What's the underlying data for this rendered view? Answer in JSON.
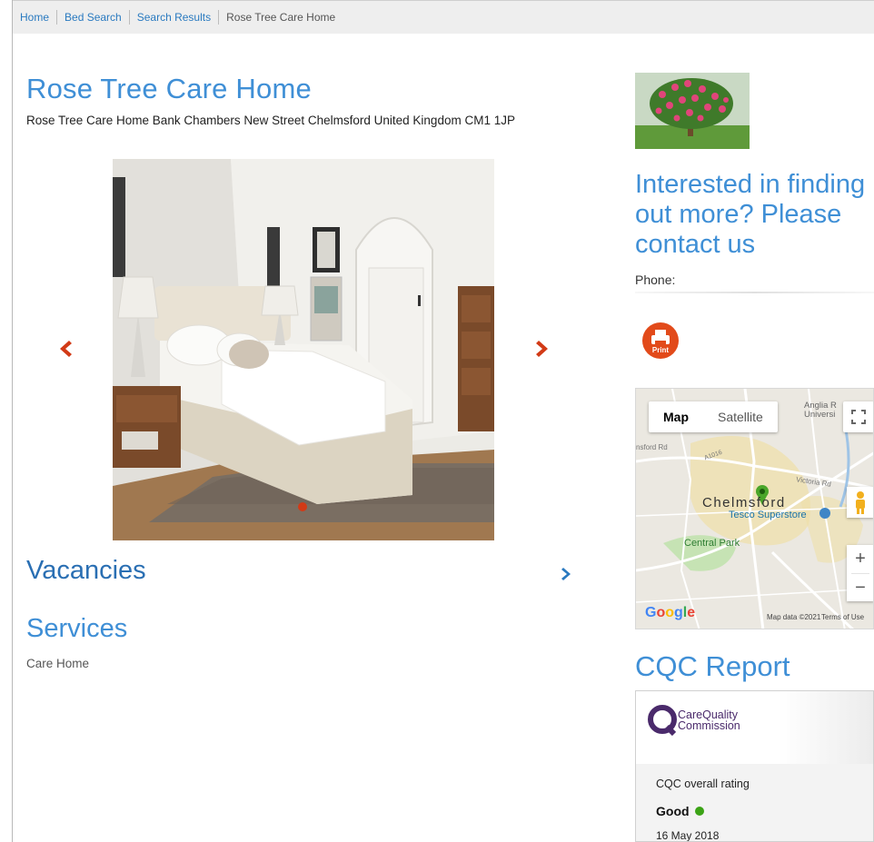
{
  "breadcrumb": {
    "items": [
      {
        "label": "Home"
      },
      {
        "label": "Bed Search"
      },
      {
        "label": "Search Results"
      }
    ],
    "current": "Rose Tree Care Home"
  },
  "home": {
    "title": "Rose Tree Care Home",
    "address": "Rose Tree Care Home Bank Chambers New Street Chelmsford United Kingdom CM1 1JP"
  },
  "carousel": {
    "prev_icon": "chevron-left-icon",
    "next_icon": "chevron-right-icon",
    "accent_color": "#d23a16"
  },
  "sections": {
    "vacancies_title": "Vacancies",
    "services_title": "Services",
    "services": [
      "Care Home"
    ]
  },
  "contact": {
    "heading_lines": [
      "Interested in finding",
      "out more? Please",
      "contact us"
    ],
    "phone_label": "Phone:",
    "print_label": "Print"
  },
  "map": {
    "type_map": "Map",
    "type_satellite": "Satellite",
    "zoom_in": "+",
    "zoom_out": "−",
    "labels": {
      "city": "Chelmsford",
      "tesco": "Tesco Superstore",
      "park": "Central Park",
      "anglia": "Anglia R\nUniversi",
      "victoria": "Victoria Rd",
      "road_left": "nsford Rd",
      "a1016": "A1016"
    },
    "google": "Google",
    "map_data": "Map data ©2021",
    "terms": "Terms of Use"
  },
  "cqc": {
    "title": "CQC Report",
    "logo_line1": "CareQuality",
    "logo_line2": "Commission",
    "rating_label": "CQC overall rating",
    "rating": "Good",
    "rating_color": "#3ba316",
    "date": "16 May 2018"
  },
  "colors": {
    "link": "#2a7ac0",
    "heading": "#3f8fd6",
    "accent": "#e24a1a"
  }
}
